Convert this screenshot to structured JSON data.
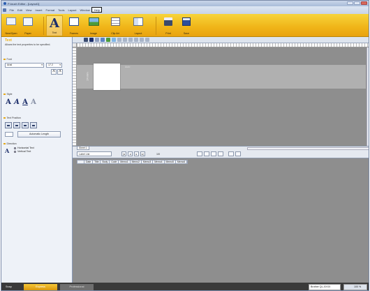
{
  "window": {
    "title": "P-touch Editor - [Layout1]"
  },
  "menu": {
    "items": [
      "File",
      "Edit",
      "View",
      "Insert",
      "Format",
      "Tools",
      "Layout",
      "Window",
      "Help"
    ],
    "highlighted": "Help"
  },
  "ribbon": {
    "buttons": [
      "New/Open",
      "Paper",
      "Text",
      "Frames",
      "Image",
      "Clip Art",
      "Layout",
      "Print",
      "Save"
    ]
  },
  "properties": {
    "title": "Text",
    "description": "Allows the text properties to be specified.",
    "font_section": "Font",
    "font_name": "Arial",
    "font_size": "17.2",
    "style_section": "Style",
    "position_section": "Text Position",
    "auto_length": "Automatic Length",
    "direction_section": "Direction",
    "horizontal": "Horizontal Text",
    "vertical": "Vertical Text"
  },
  "canvas": {
    "tape_label": "24 mm",
    "length_label": "Auto",
    "sheet_tab": "Sheet 1"
  },
  "database": {
    "list_label": "Label List",
    "record_count": "1/0",
    "columns": [
      "Date",
      "Title",
      "Body",
      "Code",
      "Memo1",
      "Memo2",
      "Memo3",
      "Memo4",
      "Memo5",
      "Memo6"
    ]
  },
  "status": {
    "snap_tab": "Snap",
    "express_tab": "Express",
    "professional_tab": "Professional",
    "printer": "Brother QL-XXXX",
    "zoom": "100 %"
  },
  "colors": {
    "ribbon": "#f0b418",
    "express_tab": "#e9a30f",
    "canvas_bg": "#8e8e8e"
  }
}
